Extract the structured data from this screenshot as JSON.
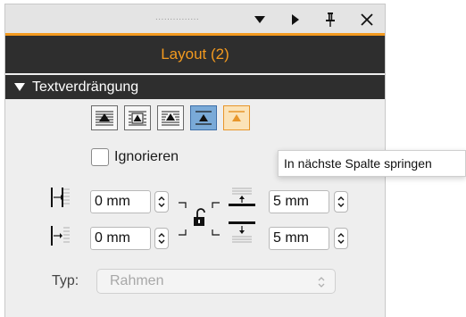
{
  "window": {
    "grip": "...............",
    "buttons": [
      "menu-arrow",
      "collapse-arrow",
      "pin",
      "close"
    ]
  },
  "panel": {
    "title": "Layout (2)",
    "section_label": "Textverdrängung",
    "accent_color": "#f39a1f",
    "header_bg": "#2e2e2e"
  },
  "wrap_options": [
    {
      "icon": "no-text-wrap-icon",
      "state": "normal"
    },
    {
      "icon": "wrap-around-bounding-box-icon",
      "state": "normal"
    },
    {
      "icon": "wrap-around-shape-icon",
      "state": "normal"
    },
    {
      "icon": "jump-object-icon",
      "state": "selected-blue"
    },
    {
      "icon": "jump-to-next-column-icon",
      "state": "selected-orange"
    }
  ],
  "ignore_checkbox": {
    "label": "Ignorieren",
    "checked": false
  },
  "tooltip": {
    "text": "In nächste Spalte springen"
  },
  "offsets": {
    "left": "0 mm",
    "right": "0 mm",
    "top": "5 mm",
    "bottom": "5 mm",
    "link": "unlocked"
  },
  "type": {
    "label": "Typ:",
    "value": "Rahmen",
    "enabled": false
  }
}
